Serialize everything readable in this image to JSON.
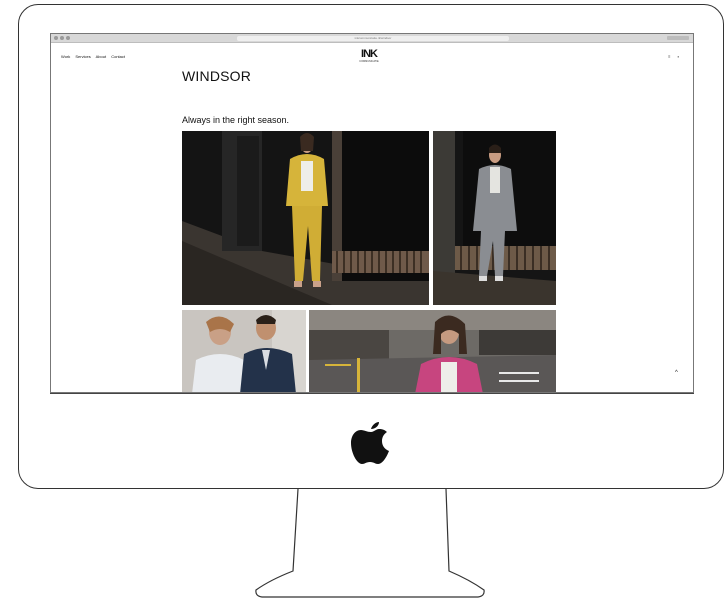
{
  "browser": {
    "url": "inkcommunicatie.nl/windsor"
  },
  "site": {
    "nav": [
      "Work",
      "Services",
      "About",
      "Contact"
    ],
    "logo_text": "INK",
    "logo_subtitle": "COMMUNICATIE",
    "util_icons": [
      "menu-icon",
      "cart-icon"
    ]
  },
  "page": {
    "title": "WINDSOR",
    "tagline": "Always in the right season."
  },
  "photos": [
    "woman-yellow-suit-storefront",
    "man-grey-suit-storefront",
    "couple-white-navy-shirts",
    "woman-pink-jacket-street"
  ],
  "colors": {
    "frame": "#333333",
    "screen_bg": "#ffffff",
    "text": "#111111"
  }
}
